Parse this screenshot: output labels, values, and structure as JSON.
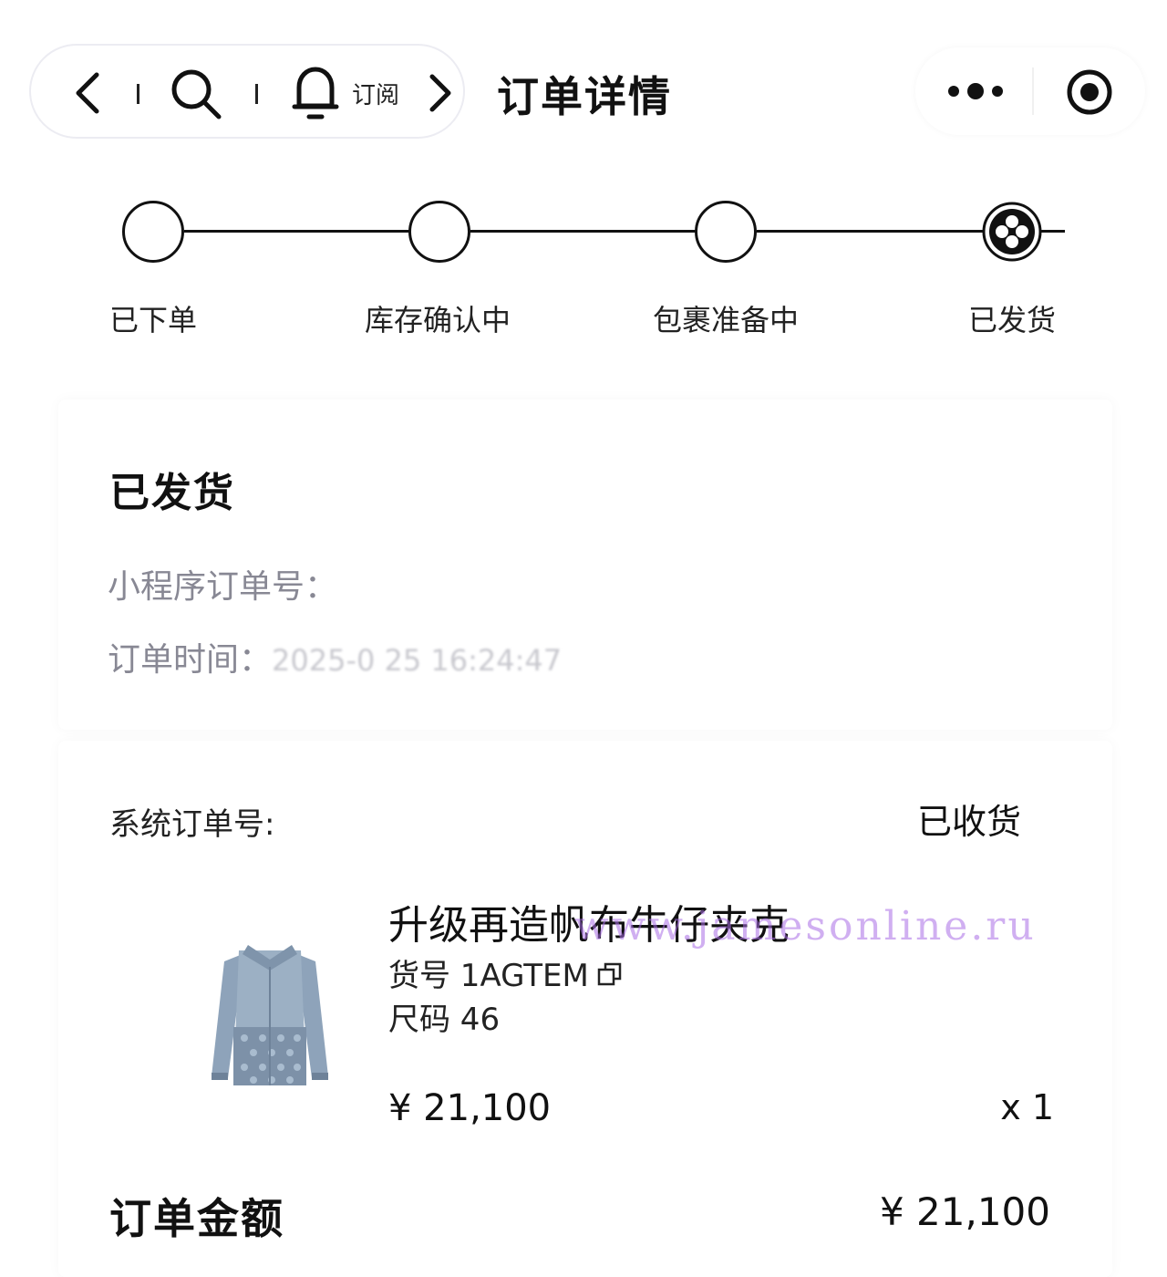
{
  "nav": {
    "subscribe_label": "订阅",
    "title": "订单详情"
  },
  "progress": {
    "steps": [
      {
        "label": "已下单"
      },
      {
        "label": "库存确认中"
      },
      {
        "label": "包裹准备中"
      },
      {
        "label": "已发货"
      }
    ],
    "current_step": 4
  },
  "status_card": {
    "title": "已发货",
    "order_no_label": "小程序订单号：",
    "order_time_label": "订单时间：",
    "order_time_value": "2025-0  25 16:24:47"
  },
  "order_card": {
    "system_order_label": "系统订单号:",
    "status": "已收货",
    "product": {
      "name": "升级再造帆布牛仔夹克",
      "sku": "货号 1AGTEM",
      "size": "尺码 46",
      "price": "¥ 21,100",
      "quantity": "x 1",
      "image_icon": "denim-jacket-image"
    },
    "total_label": "订单金额",
    "total_value": "¥ 21,100"
  },
  "watermark": "www.jamesonline.ru",
  "colors": {
    "text_primary": "#111111",
    "text_muted": "#888894",
    "watermark": "#aa6ee6"
  }
}
